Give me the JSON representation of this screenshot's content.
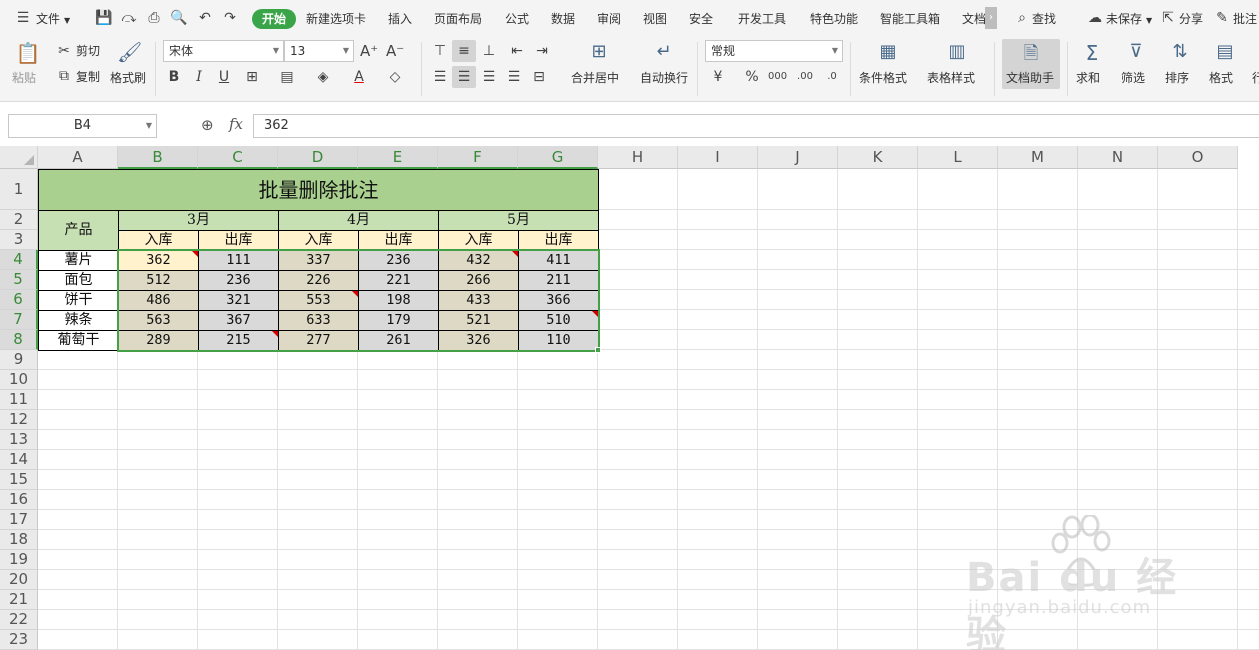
{
  "menubar": {
    "file_label": "文件",
    "tabs": [
      {
        "id": "start",
        "label": "开始",
        "active": true
      },
      {
        "id": "new-tab",
        "label": "新建选项卡"
      },
      {
        "id": "insert",
        "label": "插入"
      },
      {
        "id": "page-layout",
        "label": "页面布局"
      },
      {
        "id": "formula",
        "label": "公式"
      },
      {
        "id": "data",
        "label": "数据"
      },
      {
        "id": "review",
        "label": "审阅"
      },
      {
        "id": "view",
        "label": "视图"
      },
      {
        "id": "security",
        "label": "安全"
      },
      {
        "id": "dev-tools",
        "label": "开发工具"
      },
      {
        "id": "special",
        "label": "特色功能"
      },
      {
        "id": "smart-tools",
        "label": "智能工具箱"
      },
      {
        "id": "doc",
        "label": "文档"
      }
    ],
    "search_label": "查找",
    "unsaved_label": "未保存",
    "share_label": "分享",
    "comment_label": "批注"
  },
  "toolbar": {
    "paste_label": "粘贴",
    "cut_label": "剪切",
    "copy_label": "复制",
    "format_painter_label": "格式刷",
    "font_name": "宋体",
    "font_size": "13",
    "merge_center_label": "合并居中",
    "wrap_label": "自动换行",
    "number_format": "常规",
    "cond_format_label": "条件格式",
    "table_style_label": "表格样式",
    "doc_helper_label": "文档助手",
    "sum_label": "求和",
    "filter_label": "筛选",
    "sort_label": "排序",
    "format_label": "格式",
    "rowcol_label": "行"
  },
  "formula_bar": {
    "cell_ref": "B4",
    "fx_label": "fx",
    "value": "362"
  },
  "sheet": {
    "columns": [
      "A",
      "B",
      "C",
      "D",
      "E",
      "F",
      "G",
      "H",
      "I",
      "J",
      "K",
      "L",
      "M",
      "N",
      "O"
    ],
    "rows": [
      "1",
      "2",
      "3",
      "4",
      "5",
      "6",
      "7",
      "8",
      "9",
      "10",
      "11",
      "12",
      "13",
      "14",
      "15",
      "16",
      "17",
      "18",
      "19",
      "20",
      "21",
      "22",
      "23"
    ],
    "title": "批量删除批注",
    "product_header": "产品",
    "months": [
      "3月",
      "4月",
      "5月"
    ],
    "sub_headers": [
      "入库",
      "出库",
      "入库",
      "出库",
      "入库",
      "出库"
    ],
    "products": [
      "薯片",
      "面包",
      "饼干",
      "辣条",
      "葡萄干"
    ],
    "values": [
      [
        "362",
        "111",
        "337",
        "236",
        "432",
        "411"
      ],
      [
        "512",
        "236",
        "226",
        "221",
        "266",
        "211"
      ],
      [
        "486",
        "321",
        "553",
        "198",
        "433",
        "366"
      ],
      [
        "563",
        "367",
        "633",
        "179",
        "521",
        "510"
      ],
      [
        "289",
        "215",
        "277",
        "261",
        "326",
        "110"
      ]
    ],
    "comment_cells": [
      "B4",
      "D6",
      "F4",
      "G7",
      "C8"
    ]
  },
  "colors": {
    "title_bg": "#a9d08e",
    "header_bg": "#c6e0b4",
    "sub_header_bg": "#fff2cc",
    "in_bg": "#ddd9c4",
    "out_bg": "#d9d9d9",
    "selection": "#43a047",
    "comment_marker": "#d10000"
  },
  "watermark": {
    "brand": "Bai du 经验",
    "url": "jingyan.baidu.com"
  }
}
